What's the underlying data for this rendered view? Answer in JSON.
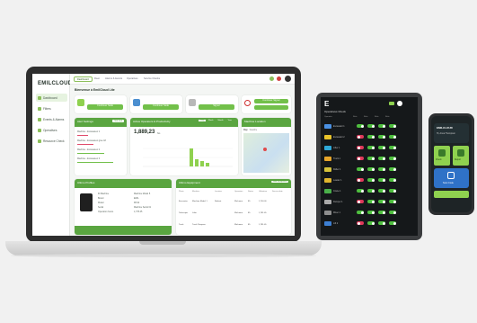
{
  "laptop": {
    "logo": "EMILCLOUD",
    "nav_items": [
      "Dashboard",
      "Filters",
      "Events & Alarms",
      "Operatives",
      "Resource Check"
    ],
    "top_tabs": [
      "Dashboard",
      "Fleet",
      "Alarms & Events",
      "Operatives",
      "Service Checks"
    ],
    "page_title": "Bienvenue à EmilCloud Lite",
    "quick_actions": [
      {
        "label": "Continuer l'aide"
      },
      {
        "label": "Continuer l'aide"
      },
      {
        "label": "Signer"
      },
      {
        "label": "Continuer Signer"
      }
    ],
    "panels": {
      "notifications": {
        "title": "Alert Settings",
        "button": "Voir tout",
        "rows": [
          "Machine - Excavateur 1",
          "Machine - Excavateur grue 18",
          "Machine - Excavateur 2",
          "Machine - Excavateur 3"
        ]
      },
      "utilization": {
        "title": "Active Operators & Productivity",
        "value": "1,889,23",
        "unit": "hrs",
        "filters": [
          "Day",
          "Week",
          "Month",
          "Year"
        ]
      },
      "map": {
        "title": "Machine Location",
        "tabs": [
          "Map",
          "Satellite"
        ]
      },
      "profile": {
        "title": "Ultimo Profiles",
        "fields": [
          [
            "ID Machine",
            "Machine Model 5"
          ],
          [
            "Brand",
            "EMIL"
          ],
          [
            "Model",
            "MX12"
          ],
          [
            "Serial",
            "Machine Serial 01"
          ],
          [
            "Operation hours",
            "1,778.45"
          ]
        ]
      },
      "equipment": {
        "title": "Ultimo Equipment",
        "button": "Add equipment",
        "headers": [
          "Photo",
          "Machine",
          "Location",
          "Operators",
          "Status",
          "Utilization",
          "Service date"
        ],
        "rows": [
          [
            "Excavator",
            "Machine Model 1",
            "Norbert",
            "Welcome",
            "85",
            "1,700.00"
          ],
          [
            "Telescopic",
            "Lifter",
            "",
            "Welcome",
            "85",
            "1,781.45"
          ],
          [
            "Truck",
            "Truck Pumpers",
            "",
            "Welcome",
            "85",
            "1,781.45"
          ]
        ]
      }
    }
  },
  "tablet": {
    "logo": "E",
    "title": "Operatives Check",
    "headers": [
      "Operator",
      "Rule",
      "Rule",
      "Rule",
      "Rule",
      "Rule"
    ],
    "rows": [
      {
        "name": "Excavator 1",
        "color": "#4a90e2",
        "toggles": [
          true,
          true,
          true,
          true
        ]
      },
      {
        "name": "Excavator 2",
        "color": "#e8c32a",
        "toggles": [
          false,
          true,
          true,
          true
        ]
      },
      {
        "name": "Lifter 1",
        "color": "#2fa9d8",
        "toggles": [
          false,
          true,
          true,
          true
        ]
      },
      {
        "name": "Truck 1",
        "color": "#e8a62a",
        "toggles": [
          false,
          true,
          true,
          true
        ]
      },
      {
        "name": "Roller 1",
        "color": "#d6c23a",
        "toggles": [
          true,
          true,
          true,
          true
        ]
      },
      {
        "name": "Loader 1",
        "color": "#e0b52e",
        "toggles": [
          false,
          true,
          true,
          true
        ]
      },
      {
        "name": "Crane 1",
        "color": "#4ab04a",
        "toggles": [
          true,
          true,
          true,
          true
        ]
      },
      {
        "name": "Dumper 1",
        "color": "#aaaaaa",
        "toggles": [
          false,
          true,
          true,
          true
        ]
      },
      {
        "name": "Mixer 1",
        "color": "#8e8e8e",
        "toggles": [
          true,
          true,
          true,
          true
        ]
      },
      {
        "name": "Lift 2",
        "color": "#3d7fd3",
        "toggles": [
          false,
          true,
          true,
          true
        ]
      }
    ]
  },
  "phone": {
    "logo": "EMILCLOUD",
    "greeting": "Hi, Anna Thompson",
    "cards": [
      {
        "label": "Check"
      },
      {
        "label": "Report"
      }
    ],
    "promo": "Scan Code"
  }
}
